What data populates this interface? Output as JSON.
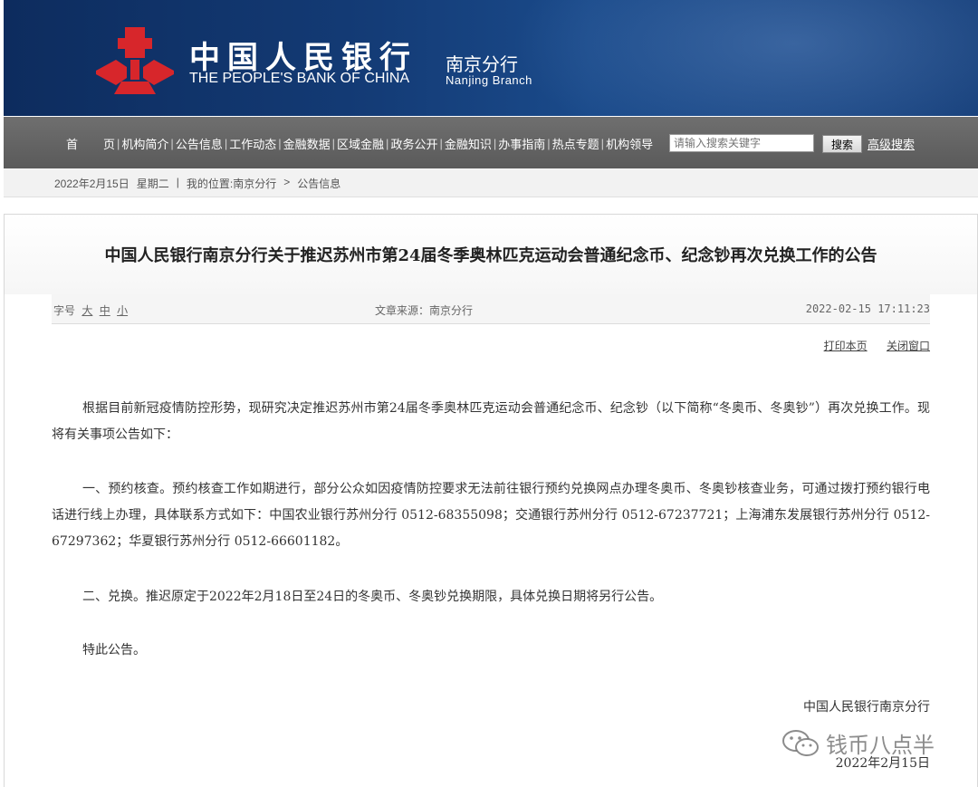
{
  "header": {
    "bank_name_cn": "中国人民银行",
    "bank_name_en": "THE PEOPLE'S BANK OF CHINA",
    "branch_cn": "南京分行",
    "branch_en": "Nanjing Branch",
    "logo_icon": "pboc-logo-icon"
  },
  "nav": {
    "items": [
      "首页",
      "机构简介",
      "公告信息",
      "工作动态",
      "金融数据",
      "区域金融",
      "政务公开",
      "金融知识",
      "办事指南",
      "热点专题",
      "机构领导"
    ],
    "search_placeholder": "请输入搜索关键字",
    "search_button": "搜索",
    "advanced_search": "高级搜索"
  },
  "breadcrumb": {
    "date": "2022年2月15日",
    "weekday": "星期二",
    "separator": "|",
    "location_label": "我的位置:南京分行",
    "arrow": ">",
    "current": "公告信息"
  },
  "article": {
    "title": "中国人民银行南京分行关于推迟苏州市第24届冬季奥林匹克运动会普通纪念币、纪念钞再次兑换工作的公告",
    "font_size_label": "字号",
    "font_sizes": [
      "大",
      "中",
      "小"
    ],
    "source": "文章来源：南京分行",
    "published": "2022-02-15 17:11:23",
    "print": "打印本页",
    "close": "关闭窗口",
    "paragraphs": [
      "根据目前新冠疫情防控形势，现研究决定推迟苏州市第24届冬季奥林匹克运动会普通纪念币、纪念钞（以下简称“冬奥币、冬奥钞”）再次兑换工作。现将有关事项公告如下：",
      "一、预约核查。预约核查工作如期进行，部分公众如因疫情防控要求无法前往银行预约兑换网点办理冬奥币、冬奥钞核查业务，可通过拨打预约银行电话进行线上办理，具体联系方式如下：中国农业银行苏州分行 0512-68355098；交通银行苏州分行 0512-67237721；上海浦东发展银行苏州分行 0512-67297362；华夏银行苏州分行 0512-66601182。",
      "二、兑换。推迟原定于2022年2月18日至24日的冬奥币、冬奥钞兑换期限，具体兑换日期将另行公告。",
      "特此公告。"
    ],
    "signature_org": "中国人民银行南京分行",
    "signature_date": "2022年2月15日"
  },
  "watermark": {
    "text": "钱币八点半",
    "icon": "wechat-icon"
  }
}
